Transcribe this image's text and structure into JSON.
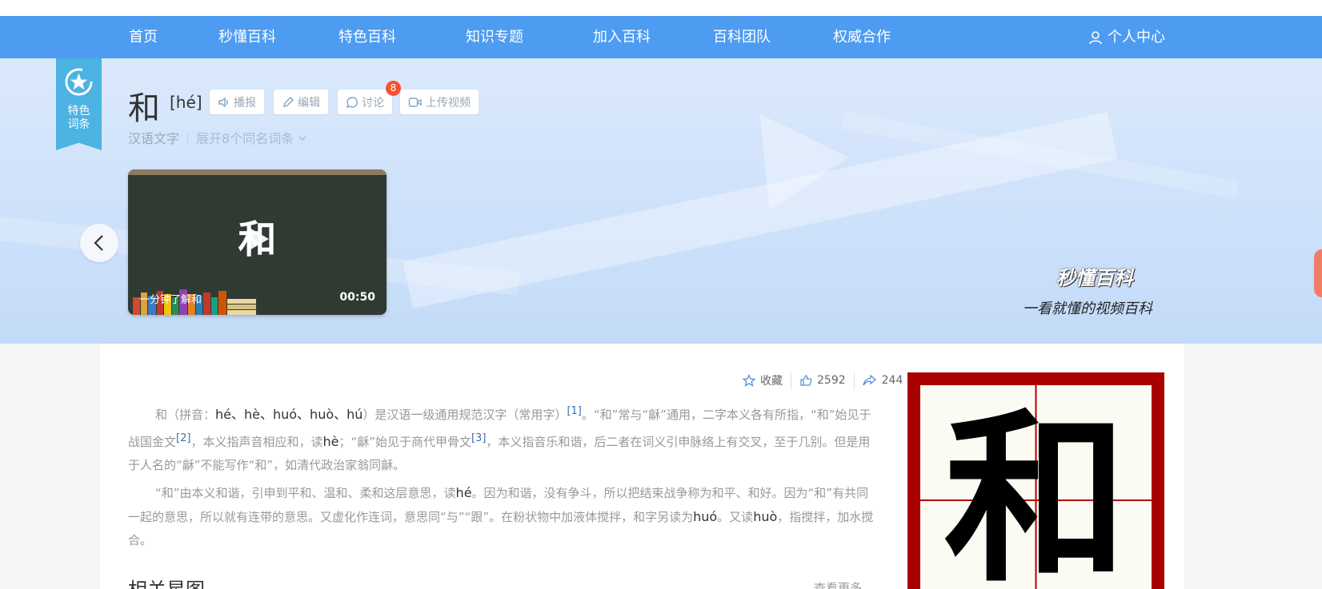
{
  "nav": {
    "items": [
      "首页",
      "秒懂百科",
      "特色百科",
      "知识专题",
      "加入百科",
      "百科团队",
      "权威合作"
    ],
    "user_label": "个人中心"
  },
  "ribbon": {
    "line1": "特色",
    "line2": "词条"
  },
  "entry": {
    "title": "和",
    "pinyin": "[hé]",
    "actions": {
      "broadcast": "播报",
      "edit": "编辑",
      "discuss": "讨论",
      "upload_video": "上传视频"
    },
    "discuss_count": "8",
    "category": "汉语文字",
    "expand_label": "展开8个同名词条"
  },
  "video": {
    "character": "和",
    "title": "一分钟了解和",
    "duration": "00:50"
  },
  "brand": {
    "logo_text": "秒懂百科",
    "slogan": "一看就懂的视频百科"
  },
  "stats": {
    "favorite_label": "收藏",
    "likes": "2592",
    "shares": "244"
  },
  "content": {
    "p1": {
      "s1": "和（拼音：",
      "pinyin1": "hé、hè、huó、huò、hú",
      "s2": "）是汉语一级通用规范汉字（常用字）",
      "ref1": "[1]",
      "s3": "。“和”常与“龢”通用，二字本义各有所指，“和”始见于战国金文",
      "ref2": "[2]",
      "s4": "，本义指声音相应和，读",
      "pinyin2": "hè",
      "s5": "；“龢”始见于商代甲骨文",
      "ref3": "[3]",
      "s6": "，本义指音乐和谐，后二者在词义引申脉络上有交叉，至于几别。但是用于人名的“龢”不能写作“和”，如清代政治家翁同龢。"
    },
    "p2": {
      "s1": "“和”由本义和谐，引申到平和、温和、柔和这层意思，读",
      "pinyin1": "hé",
      "s2": "。因为和谐，没有争斗，所以把结束战争称为和平、和好。因为“和”有共同一起的意思，所以就有连带的意思。又虚化作连词，意思同“与”“跟”。在粉状物中加液体搅拌，和字另读为",
      "pinyin2": "huó",
      "s3": "。又读",
      "pinyin3": "huò",
      "s4": "，指搅拌，加水搅合。"
    },
    "related_title": "相关星图",
    "more_label": "查看更多"
  },
  "char_image": {
    "character": "和"
  },
  "colors": {
    "nav_bg": "#4d9cf2",
    "ribbon": "#4cb3e3",
    "badge": "#f55233",
    "char_border": "#a90000"
  }
}
